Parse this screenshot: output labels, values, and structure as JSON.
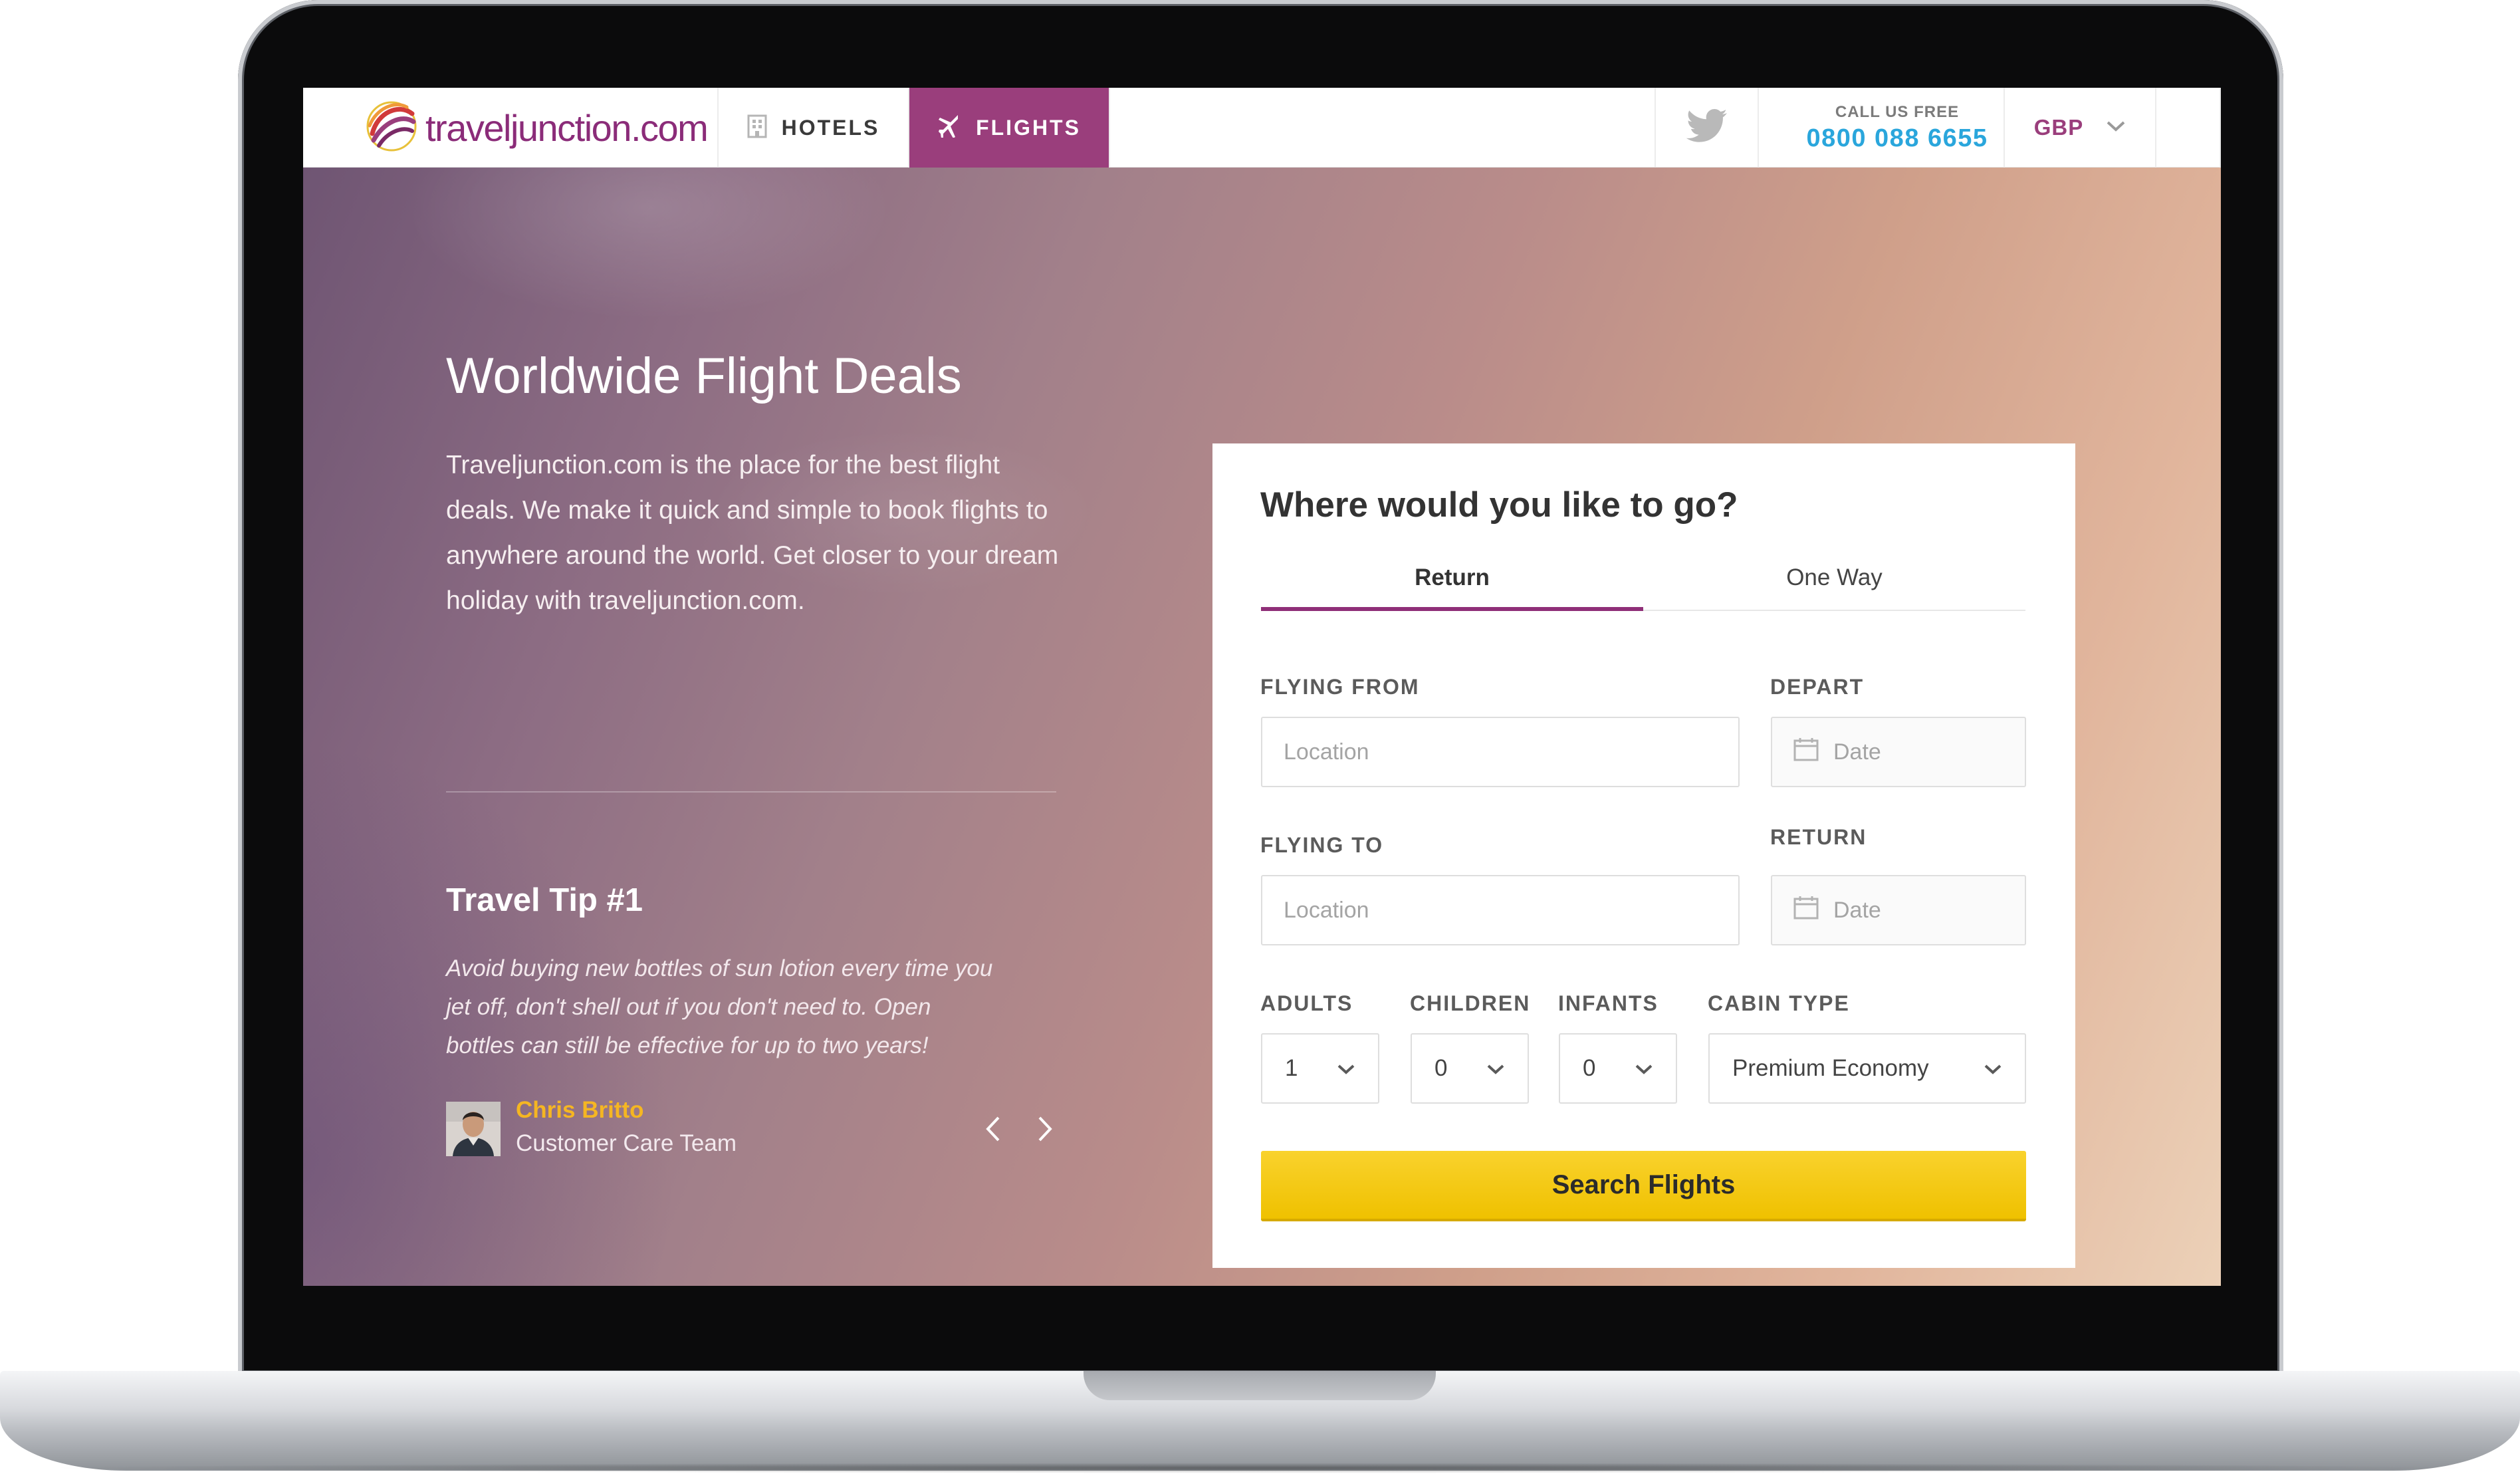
{
  "nav": {
    "logo_text": "traveljunction",
    "logo_suffix": ".com",
    "hotels_label": "HOTELS",
    "flights_label": "FLIGHTS",
    "call_label": "CALL US FREE",
    "call_number": "0800 088 6655",
    "currency": "GBP"
  },
  "hero": {
    "title": "Worldwide Flight Deals",
    "description": "Traveljunction.com is the place for the best flight deals. We make it quick and simple to book flights to anywhere around the world. Get closer to your dream holiday with traveljunction.com.",
    "tip_title": "Travel Tip #1",
    "tip_text": "Avoid buying new bottles of sun lotion every time you jet off, don't shell out if you don't need to. Open bottles can still be effective for up to two years!",
    "author_name": "Chris Britto",
    "author_role": "Customer Care Team"
  },
  "search": {
    "title": "Where would you like to go?",
    "tabs": [
      {
        "label": "Return",
        "active": true
      },
      {
        "label": "One Way",
        "active": false
      }
    ],
    "flying_from_label": "FLYING FROM",
    "flying_from_placeholder": "Location",
    "depart_label": "DEPART",
    "depart_placeholder": "Date",
    "flying_to_label": "FLYING TO",
    "flying_to_placeholder": "Location",
    "return_label": "RETURN",
    "return_placeholder": "Date",
    "adults_label": "ADULTS",
    "adults_value": "1",
    "children_label": "CHILDREN",
    "children_value": "0",
    "infants_label": "INFANTS",
    "infants_value": "0",
    "cabin_label": "CABIN TYPE",
    "cabin_value": "Premium Economy",
    "button_label": "Search Flights"
  },
  "colors": {
    "brand": "#9a3e7c",
    "phone": "#2aa6dc",
    "author": "#f5b622",
    "button": "#f5cb12"
  },
  "icons": [
    "logo-swirl-icon",
    "hotel-building-icon",
    "plane-icon",
    "twitter-icon",
    "chevron-down-icon",
    "calendar-icon",
    "chevron-left-icon",
    "chevron-right-icon"
  ]
}
